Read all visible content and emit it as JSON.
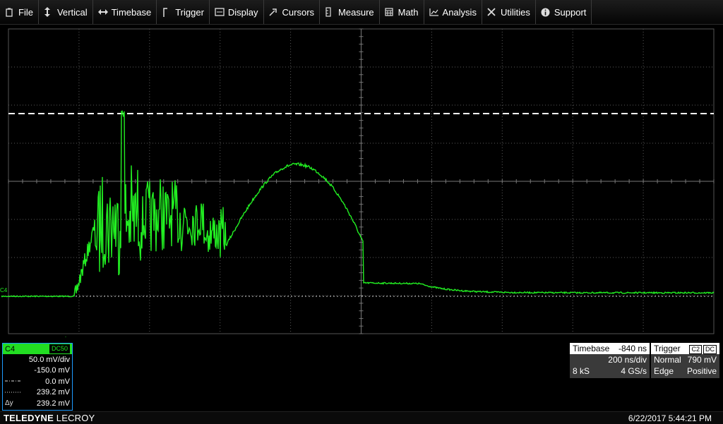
{
  "menu": {
    "items": [
      {
        "label": "File",
        "icon": "file-icon"
      },
      {
        "label": "Vertical",
        "icon": "vertical-arrows-icon"
      },
      {
        "label": "Timebase",
        "icon": "horizontal-arrows-icon"
      },
      {
        "label": "Trigger",
        "icon": "trigger-icon"
      },
      {
        "label": "Display",
        "icon": "display-icon"
      },
      {
        "label": "Cursors",
        "icon": "cursor-icon"
      },
      {
        "label": "Measure",
        "icon": "measure-icon"
      },
      {
        "label": "Math",
        "icon": "calculator-icon"
      },
      {
        "label": "Analysis",
        "icon": "analysis-icon"
      },
      {
        "label": "Utilities",
        "icon": "tools-icon"
      },
      {
        "label": "Support",
        "icon": "info-icon"
      }
    ]
  },
  "trace": {
    "label": "C4",
    "color": "#22ee22",
    "grid_color": "#5a5a5a",
    "cursor_color": "#ffffff"
  },
  "channel": {
    "name": "C4",
    "coupling": "DC50",
    "vdiv": "50.0 mV/div",
    "offset": "-150.0 mV",
    "cursor1_value": "0.0 mV",
    "cursor2_value": "239.2 mV",
    "delta_label": "Δy",
    "delta_value": "239.2 mV"
  },
  "timebase": {
    "title": "Timebase",
    "delay": "-840 ns",
    "tdiv": "200 ns/div",
    "samples": "8 kS",
    "rate": "4 GS/s"
  },
  "trigger": {
    "title": "Trigger",
    "source_tag": "C2",
    "coupling_tag": "DC",
    "mode": "Normal",
    "level": "790 mV",
    "type": "Edge",
    "slope": "Positive"
  },
  "footer": {
    "brand_bold": "TELEDYNE",
    "brand_rest": " LECROY",
    "datetime": "6/22/2017 5:44:21 PM"
  }
}
